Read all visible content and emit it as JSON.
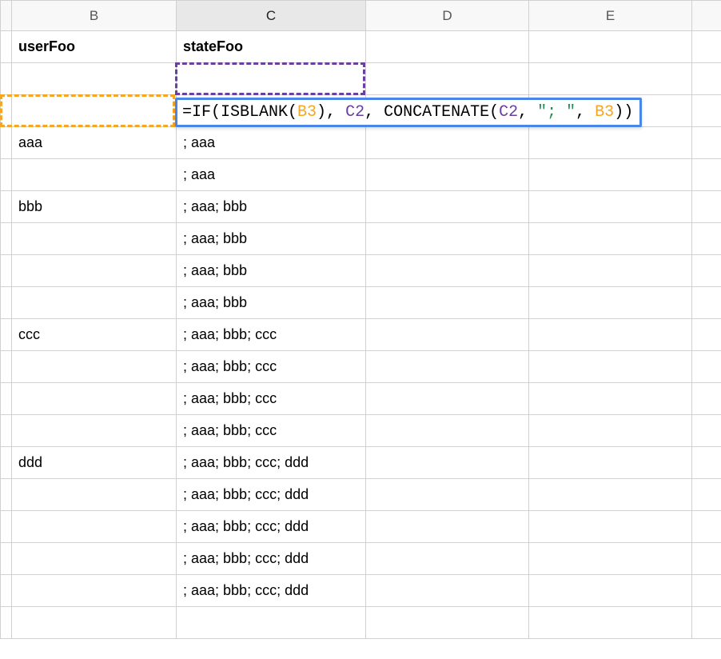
{
  "columns": {
    "B": "B",
    "C": "C",
    "D": "D",
    "E": "E"
  },
  "activeColumn": "C",
  "headers": {
    "B": "userFoo",
    "C": "stateFoo"
  },
  "rows": [
    {
      "B": "userFoo",
      "C": "stateFoo",
      "bold": true
    },
    {
      "B": "",
      "C": ""
    },
    {
      "B": "",
      "C": ""
    },
    {
      "B": "aaa",
      "C": "; aaa"
    },
    {
      "B": "",
      "C": "; aaa"
    },
    {
      "B": "bbb",
      "C": "; aaa; bbb"
    },
    {
      "B": "",
      "C": "; aaa; bbb"
    },
    {
      "B": "",
      "C": "; aaa; bbb"
    },
    {
      "B": "",
      "C": "; aaa; bbb"
    },
    {
      "B": "ccc",
      "C": "; aaa; bbb; ccc"
    },
    {
      "B": "",
      "C": "; aaa; bbb; ccc"
    },
    {
      "B": "",
      "C": "; aaa; bbb; ccc"
    },
    {
      "B": "",
      "C": "; aaa; bbb; ccc"
    },
    {
      "B": "ddd",
      "C": "; aaa; bbb; ccc; ddd"
    },
    {
      "B": "",
      "C": "; aaa; bbb; ccc; ddd"
    },
    {
      "B": "",
      "C": "; aaa; bbb; ccc; ddd"
    },
    {
      "B": "",
      "C": "; aaa; bbb; ccc; ddd"
    },
    {
      "B": "",
      "C": "; aaa; bbb; ccc; ddd"
    },
    {
      "B": "",
      "C": ""
    }
  ],
  "formula": {
    "tokens": [
      {
        "t": "=IF(ISBLANK(",
        "c": "black"
      },
      {
        "t": "B3",
        "c": "orange"
      },
      {
        "t": "), ",
        "c": "black"
      },
      {
        "t": "C2",
        "c": "purple"
      },
      {
        "t": ", CONCATENATE(",
        "c": "black"
      },
      {
        "t": "C2",
        "c": "purple"
      },
      {
        "t": ", ",
        "c": "black"
      },
      {
        "t": "\"; \"",
        "c": "green"
      },
      {
        "t": ", ",
        "c": "black"
      },
      {
        "t": "B3",
        "c": "orange"
      },
      {
        "t": "))",
        "c": "black"
      }
    ],
    "plain": "=IF(ISBLANK(B3), C2, CONCATENATE(C2, \"; \", B3))"
  },
  "references": {
    "orange": {
      "cell": "B3"
    },
    "purple": {
      "cell": "C2"
    }
  }
}
